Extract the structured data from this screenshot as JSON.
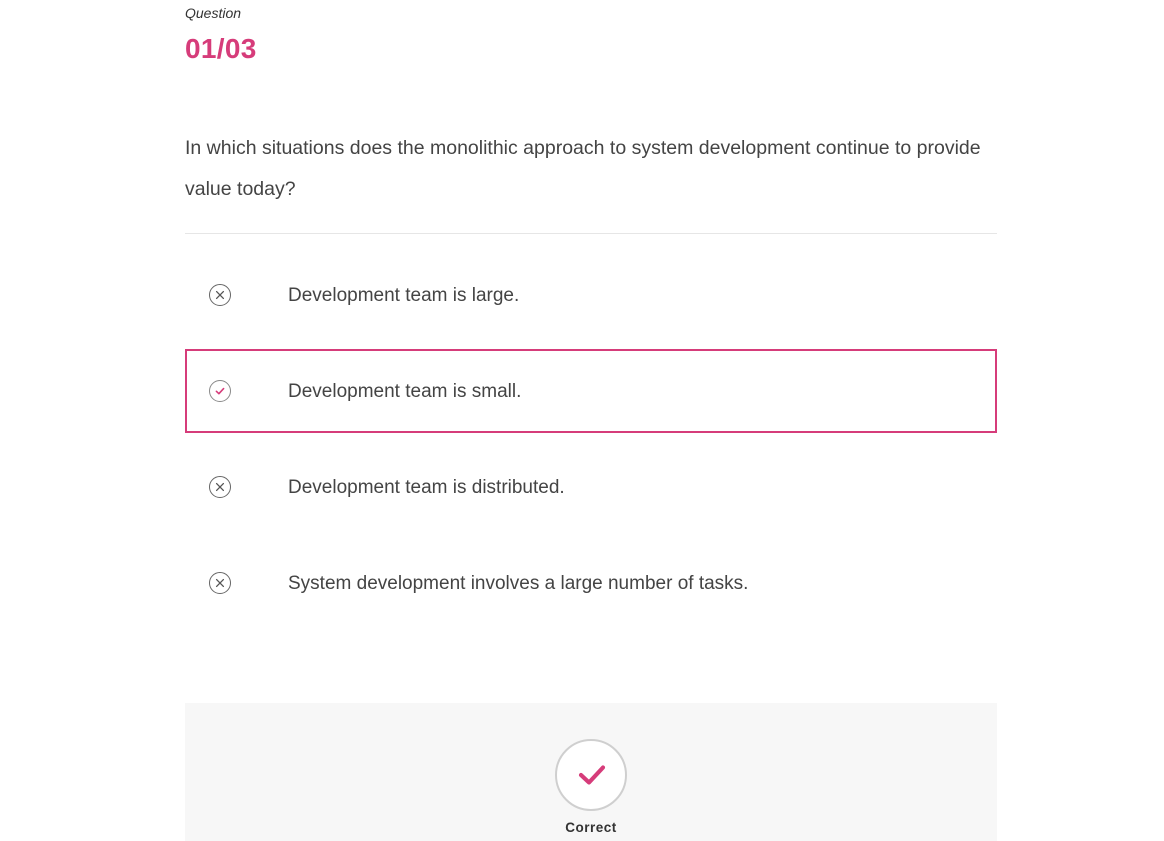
{
  "question": {
    "label": "Question",
    "number": "01/03",
    "text": "In which situations does the monolithic approach to system development continue to provide value today?"
  },
  "options": [
    {
      "text": "Development team is large.",
      "status": "incorrect",
      "icon": "close-circle-icon",
      "selected": false
    },
    {
      "text": "Development team is small.",
      "status": "correct",
      "icon": "check-circle-icon",
      "selected": true
    },
    {
      "text": "Development team is distributed.",
      "status": "incorrect",
      "icon": "close-circle-icon",
      "selected": false
    },
    {
      "text": "System development involves a large number of tasks.",
      "status": "incorrect",
      "icon": "close-circle-icon",
      "selected": false
    }
  ],
  "result": {
    "label": "Correct",
    "icon": "checkmark-icon"
  },
  "colors": {
    "accent": "#d63c7a",
    "text": "#444444",
    "panel_bg": "#f7f7f7",
    "divider": "#e6e6e6"
  }
}
